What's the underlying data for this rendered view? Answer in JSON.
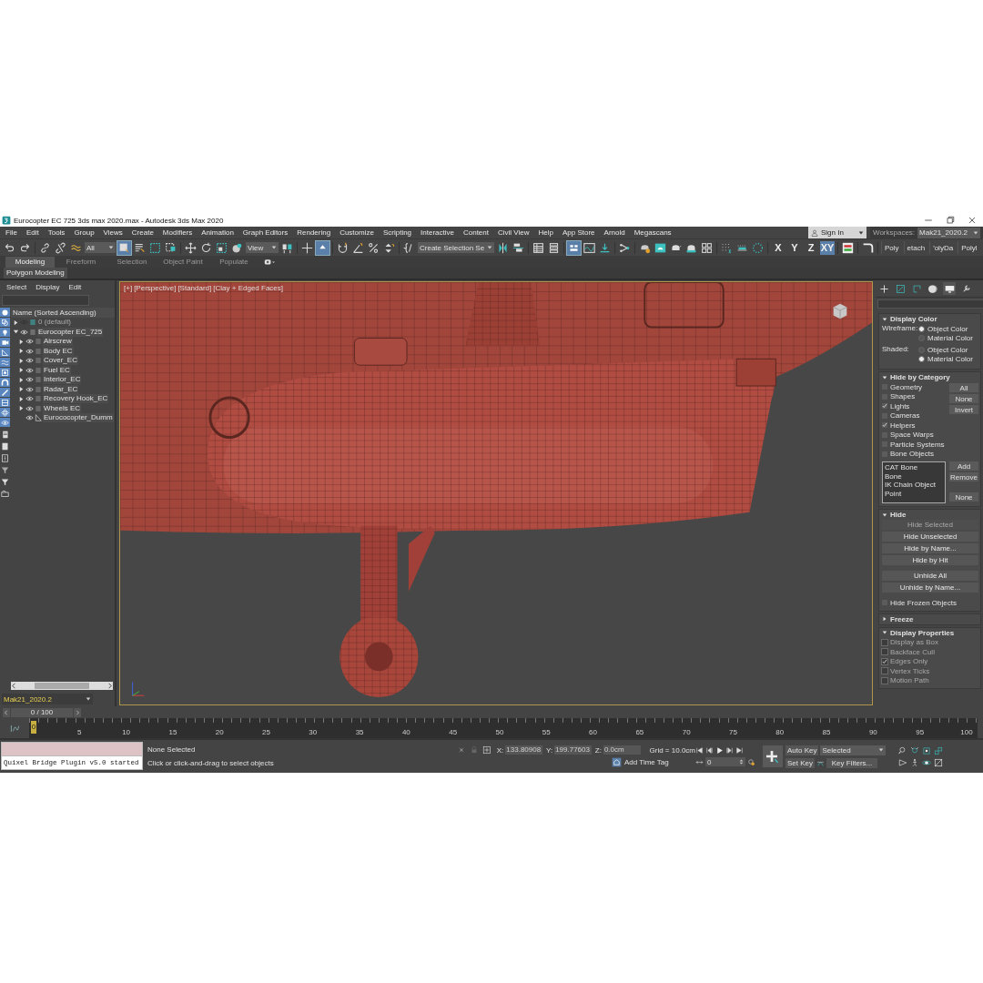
{
  "window": {
    "title": "Eurocopter EC 725 3ds max 2020.max - Autodesk 3ds Max 2020"
  },
  "menu": [
    "File",
    "Edit",
    "Tools",
    "Group",
    "Views",
    "Create",
    "Modifiers",
    "Animation",
    "Graph Editors",
    "Rendering",
    "Customize",
    "Scripting",
    "Interactive",
    "Content",
    "Civil View",
    "Help",
    "App Store",
    "Arnold",
    "Megascans"
  ],
  "account": {
    "label": "Sign In"
  },
  "workspaces": {
    "label": "Workspaces:",
    "value": "Mak21_2020.2"
  },
  "toolbar": {
    "selection_filter": "All",
    "reference_coord": "View",
    "named_selection": "Create Selection Se",
    "axis_buttons": [
      {
        "label": "X",
        "selected": false
      },
      {
        "label": "Y",
        "selected": false
      },
      {
        "label": "Z",
        "selected": false
      },
      {
        "label": "XY",
        "selected": true
      }
    ],
    "graphite_buttons": [
      "Poly",
      "etach",
      "'olyDa",
      "Polyl"
    ]
  },
  "ribbon": {
    "tabs": [
      {
        "label": "Modeling",
        "selected": true
      },
      {
        "label": "Freeform",
        "selected": false
      },
      {
        "label": "Selection",
        "selected": false
      },
      {
        "label": "Object Paint",
        "selected": false
      },
      {
        "label": "Populate",
        "selected": false
      }
    ],
    "panel": "Polygon Modeling"
  },
  "scene_explorer": {
    "menu": [
      "Select",
      "Display",
      "Edit"
    ],
    "column": "Name (Sorted Ascending)",
    "tree": [
      {
        "name": "0 (default)",
        "kind": "layer",
        "visible": false,
        "expanded": false
      },
      {
        "name": "Eurocopter EC_725",
        "kind": "group",
        "visible": true,
        "expanded": true,
        "children": [
          {
            "name": "Airscrew",
            "kind": "layer",
            "visible": true,
            "expanded": false
          },
          {
            "name": "Body EC",
            "kind": "layer",
            "visible": true,
            "expanded": false
          },
          {
            "name": "Cover_EC",
            "kind": "layer",
            "visible": true,
            "expanded": false
          },
          {
            "name": "Fuel EC",
            "kind": "layer",
            "visible": true,
            "expanded": false
          },
          {
            "name": "Interior_EC",
            "kind": "layer",
            "visible": true,
            "expanded": false
          },
          {
            "name": "Radar_EC",
            "kind": "layer",
            "visible": true,
            "expanded": false
          },
          {
            "name": "Recovery Hook_EC",
            "kind": "layer",
            "visible": true,
            "expanded": false
          },
          {
            "name": "Wheels EC",
            "kind": "layer",
            "visible": true,
            "expanded": false
          },
          {
            "name": "Eurococopter_Dumm",
            "kind": "helper",
            "visible": true
          }
        ]
      }
    ],
    "layer": "Mak21_2020.2"
  },
  "viewport": {
    "labels": [
      "[+]",
      "[Perspective]",
      "[Standard]",
      "[Clay + Edged Faces]"
    ]
  },
  "display_panel": {
    "rollouts": [
      {
        "title": "Display Color",
        "kind": "display_color",
        "expanded": true,
        "groups": [
          {
            "label": "Wireframe:",
            "options": [
              {
                "label": "Object Color",
                "selected": true
              },
              {
                "label": "Material Color",
                "selected": false
              }
            ]
          },
          {
            "label": "Shaded:",
            "options": [
              {
                "label": "Object Color",
                "selected": false
              },
              {
                "label": "Material Color",
                "selected": true
              }
            ]
          }
        ]
      },
      {
        "title": "Hide by Category",
        "kind": "hide_by_category",
        "expanded": true,
        "checks": [
          {
            "label": "Geometry",
            "checked": false
          },
          {
            "label": "Shapes",
            "checked": false
          },
          {
            "label": "Lights",
            "checked": true
          },
          {
            "label": "Cameras",
            "checked": false
          },
          {
            "label": "Helpers",
            "checked": true
          },
          {
            "label": "Space Warps",
            "checked": false
          },
          {
            "label": "Particle Systems",
            "checked": false
          },
          {
            "label": "Bone Objects",
            "checked": false
          }
        ],
        "buttons": [
          "All",
          "None",
          "Invert"
        ],
        "list": [
          "CAT Bone",
          "Bone",
          "IK Chain Object",
          "Point"
        ],
        "list_buttons": [
          "Add",
          "Remove",
          "None"
        ]
      },
      {
        "title": "Hide",
        "kind": "hide",
        "expanded": true,
        "button_groups": [
          [
            {
              "label": "Hide Selected",
              "disabled": true
            },
            {
              "label": "Hide Unselected",
              "disabled": false
            },
            {
              "label": "Hide by Name...",
              "disabled": false
            },
            {
              "label": "Hide by Hit",
              "disabled": false
            }
          ],
          [
            {
              "label": "Unhide All",
              "disabled": false
            },
            {
              "label": "Unhide by Name...",
              "disabled": false
            }
          ]
        ],
        "checks": [
          {
            "label": "Hide Frozen Objects",
            "checked": false,
            "disabled": false
          }
        ]
      },
      {
        "title": "Freeze",
        "expanded": false
      },
      {
        "title": "Display Properties",
        "kind": "display_properties",
        "expanded": true,
        "checks": [
          {
            "label": "Display as Box",
            "checked": false,
            "disabled": true
          },
          {
            "label": "Backface Cull",
            "checked": false,
            "disabled": true
          },
          {
            "label": "Edges Only",
            "checked": true,
            "disabled": true
          },
          {
            "label": "Vertex Ticks",
            "checked": false,
            "disabled": true
          },
          {
            "label": "Motion Path",
            "checked": false,
            "disabled": true
          }
        ]
      }
    ]
  },
  "time_slider": {
    "label": "0 / 100",
    "frame": "0"
  },
  "track_bar": {
    "ticks": [
      "5",
      "10",
      "15",
      "20",
      "25",
      "30",
      "35",
      "40",
      "45",
      "50",
      "55",
      "60",
      "65",
      "70",
      "75",
      "80",
      "85",
      "90",
      "95",
      "100"
    ]
  },
  "status_bar": {
    "listener": "Quixel Bridge Plugin v5.0 started",
    "selection": "None Selected",
    "prompt": "Click or click-and-drag to select objects",
    "coords": [
      {
        "label": "X:",
        "value": "133.80908"
      },
      {
        "label": "Y:",
        "value": "199.77603"
      },
      {
        "label": "Z:",
        "value": "0.0cm"
      }
    ],
    "grid": "Grid = 10.0cm",
    "time_tag": "Add Time Tag",
    "current_frame": "0",
    "auto_key": "Auto Key",
    "set_key": "Set Key",
    "key_mode": "Selected",
    "key_filters": "Key Filters..."
  }
}
